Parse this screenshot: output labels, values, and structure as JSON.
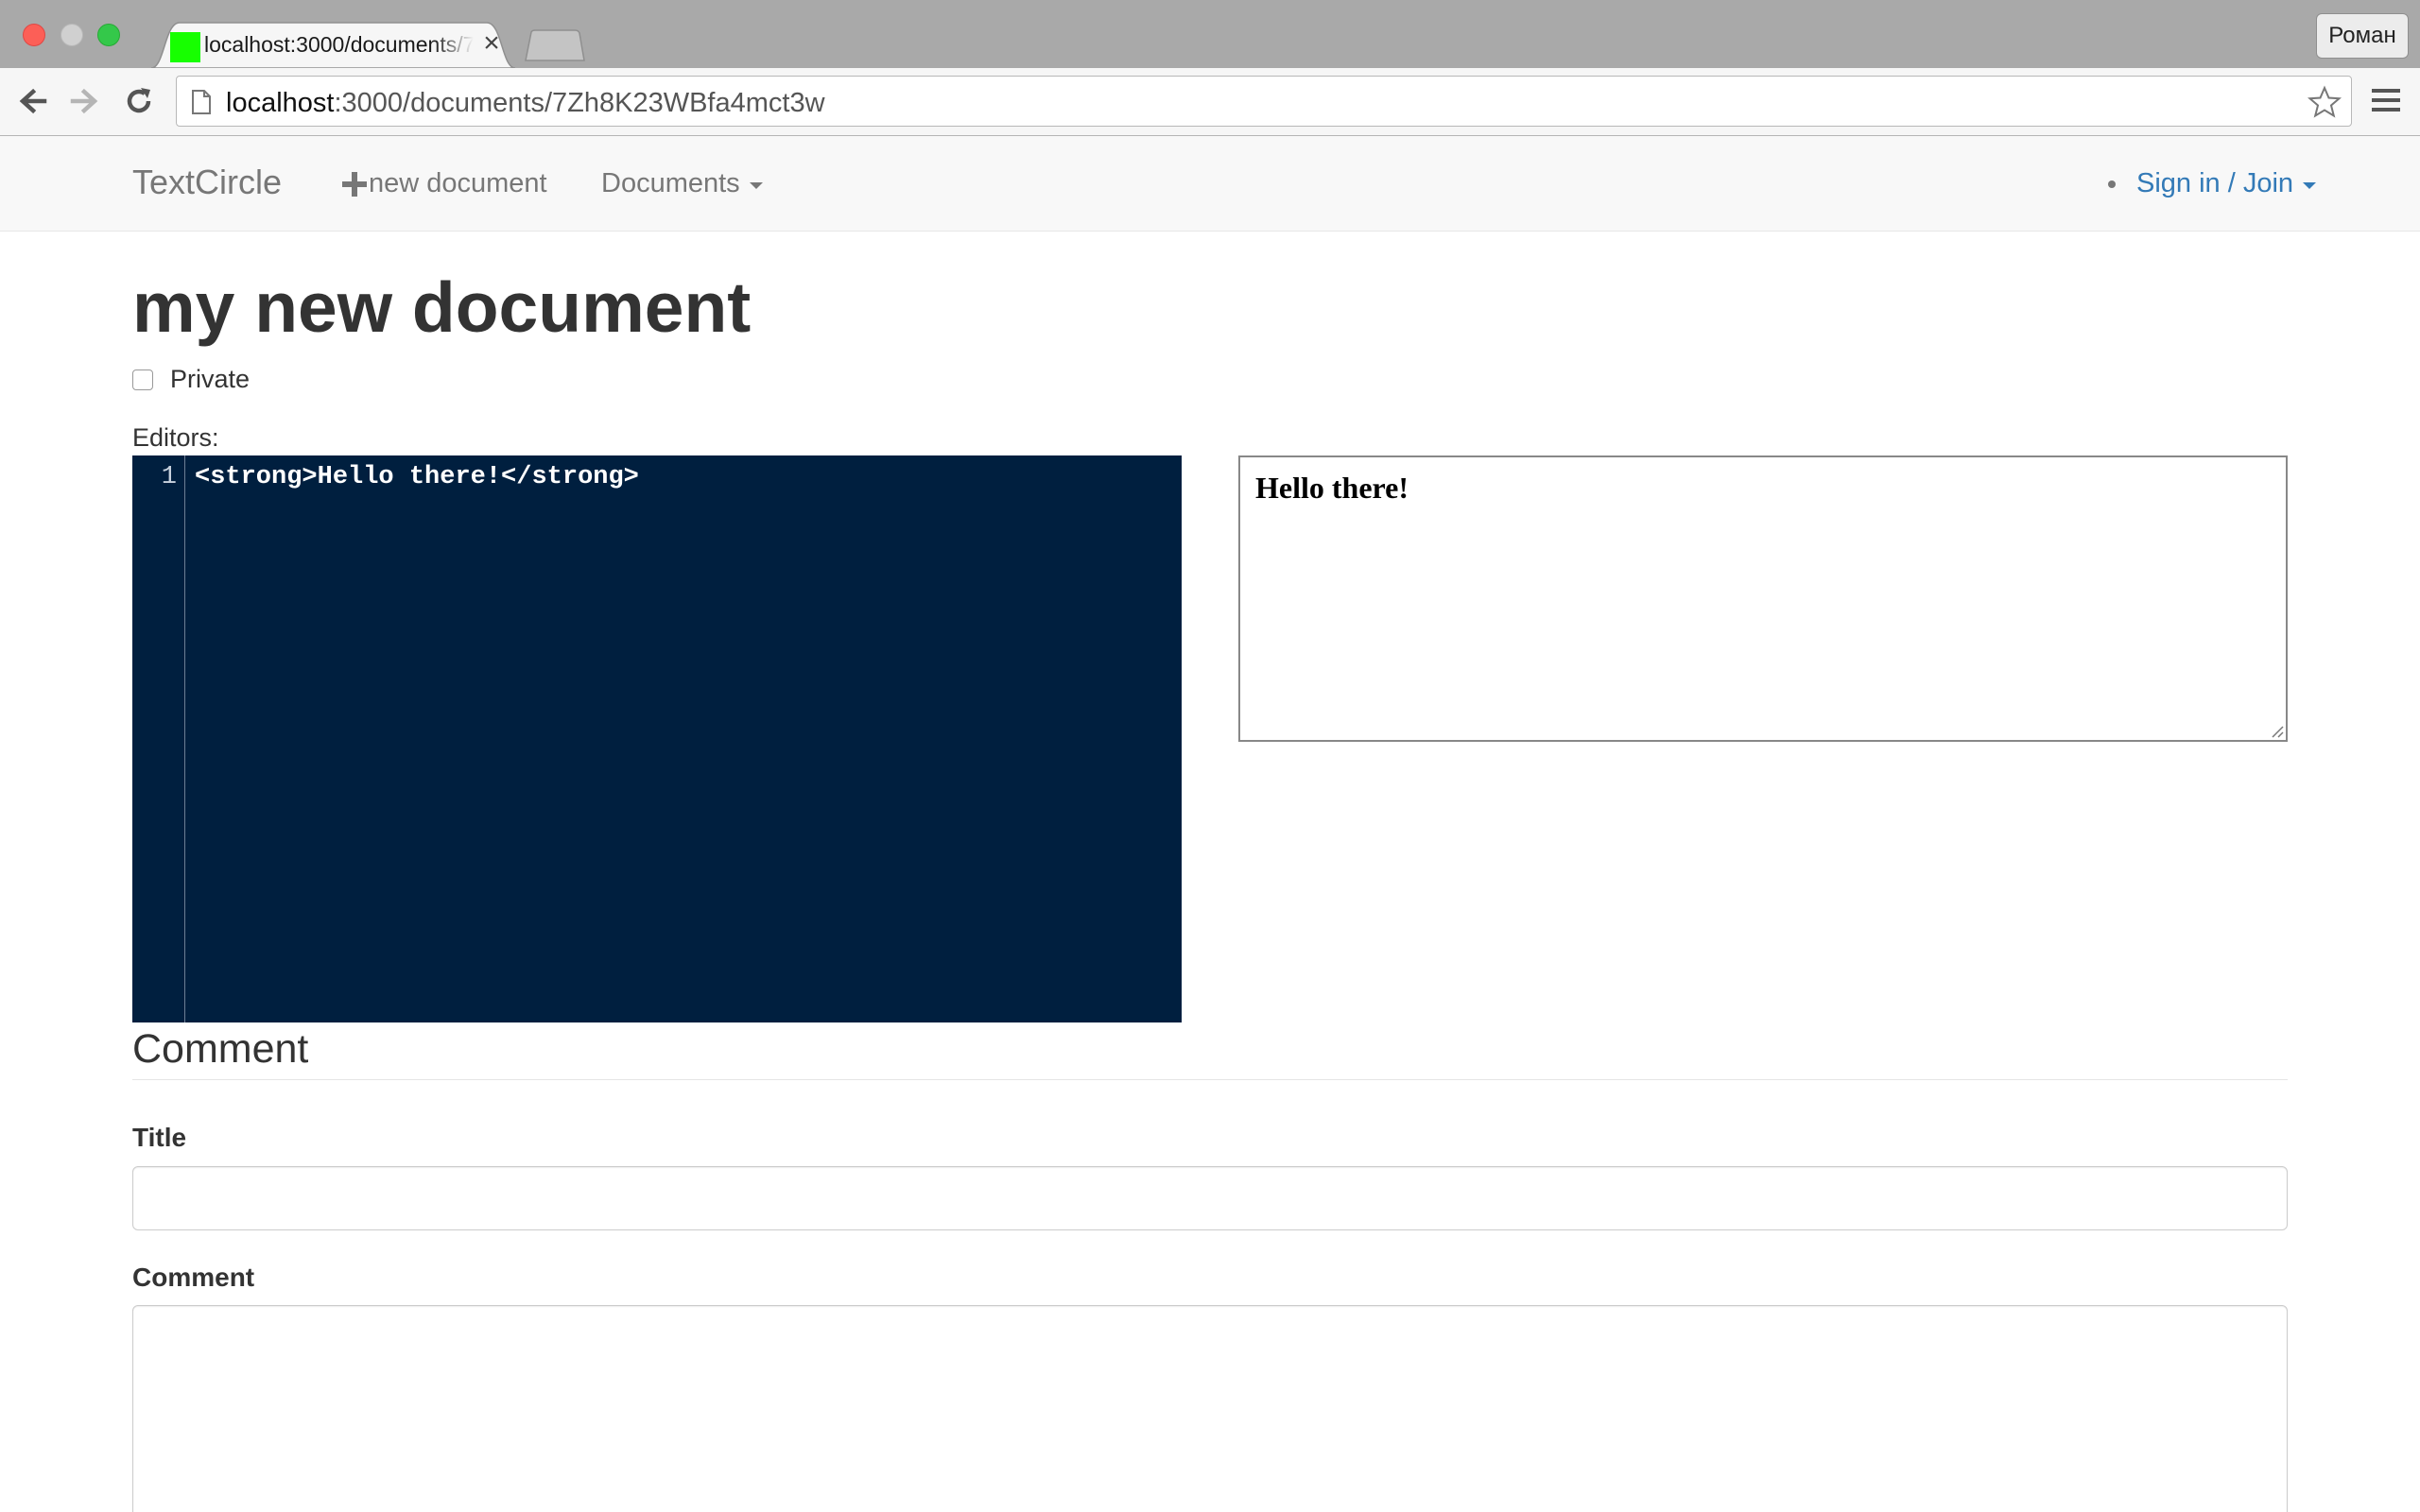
{
  "browser": {
    "tab": {
      "title": "localhost:3000/documents/7Zh8K23WBfa4mct3w",
      "favicon_color": "#17ff00"
    },
    "profile_name": "Роман",
    "address": {
      "host": "localhost",
      "path": ":3000/documents/7Zh8K23WBfa4mct3w"
    },
    "icons": [
      "back-icon",
      "forward-icon",
      "reload-icon",
      "page-icon",
      "star-icon",
      "menu-icon",
      "close-icon"
    ]
  },
  "navbar": {
    "brand": "TextCircle",
    "new_document": "new document",
    "documents": "Documents",
    "signin": "Sign in / Join",
    "link_color": "#337ab7"
  },
  "document": {
    "title": "my new document",
    "private_label": "Private",
    "private_checked": false,
    "editors_label": "Editors:",
    "editor": {
      "line_number": "1",
      "code": "<strong>Hello there!</strong>",
      "background": "#001f3f"
    },
    "preview_text": "Hello there!"
  },
  "comment": {
    "section_title": "Comment",
    "title_label": "Title",
    "title_value": "",
    "comment_label": "Comment",
    "comment_value": ""
  }
}
